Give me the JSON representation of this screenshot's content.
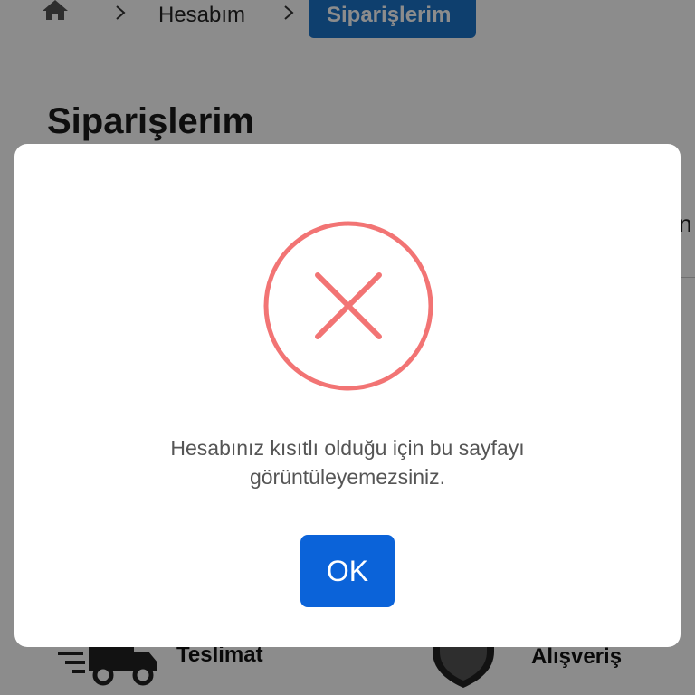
{
  "breadcrumb": {
    "home_icon": "home-icon",
    "items": [
      "Hesabım",
      "Siparişlerim"
    ],
    "separator_icon": "chevron-right-icon",
    "active_color": "#1a73c8"
  },
  "page": {
    "title": "Siparişlerim",
    "card_edge_text": "n"
  },
  "features": {
    "delivery_label": "Teslimat",
    "delivery_icon": "delivery-truck-icon",
    "shopping_label": "Alışveriş",
    "shopping_icon": "shield-icon"
  },
  "dialog": {
    "icon": "error-x-icon",
    "icon_color": "#f27474",
    "message_line1": "Hesabınız kısıtlı olduğu için bu sayfayı",
    "message_line2": "görüntüleyemezsiniz.",
    "ok_label": "OK",
    "ok_color": "#0b63d9"
  }
}
